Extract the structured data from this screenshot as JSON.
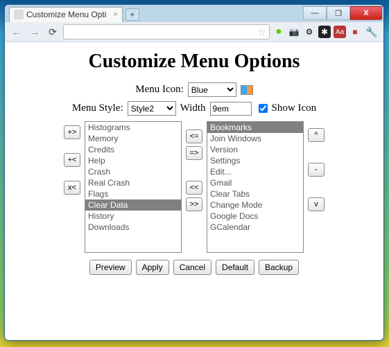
{
  "window": {
    "tab_title": "Customize Menu Opti",
    "tab_close": "×",
    "new_tab": "+",
    "min": "—",
    "max": "❐",
    "close": "X"
  },
  "toolbar": {
    "back": "←",
    "forward": "→",
    "reload": "⟳",
    "star": "☆",
    "wrench": "🔧"
  },
  "ext_icons": {
    "green": "●",
    "camera": "📷",
    "gears": "⚙",
    "asterisk": "✱",
    "aa": "Aa",
    "red": "■"
  },
  "page": {
    "title": "Customize Menu Options",
    "menu_icon_label": "Menu Icon:",
    "menu_icon_value": "Blue",
    "menu_style_label": "Menu Style:",
    "menu_style_value": "Style2",
    "width_label": "Width",
    "width_value": "9em",
    "show_icon_label": "Show Icon"
  },
  "left_list": {
    "items": [
      "Histograms",
      "Memory",
      "Credits",
      "Help",
      "Crash",
      "Real Crash",
      "Flags",
      "Clear Data",
      "History",
      "Downloads"
    ],
    "selected_index": 7
  },
  "right_list": {
    "items": [
      "Bookmarks",
      "Join Windows",
      "Version",
      "Settings",
      "Edit...",
      "Gmail",
      "Clear Tabs",
      "Change Mode",
      "Google Docs",
      "GCalendar"
    ],
    "selected_index": 0
  },
  "buttons": {
    "add_all": "+>",
    "add_sel": "+<",
    "remove": "x<",
    "move_left": "<=",
    "move_right": "=>",
    "move_far_left": "<<",
    "move_far_right": ">>",
    "up": "^",
    "mid": "-",
    "down": "v",
    "preview": "Preview",
    "apply": "Apply",
    "cancel": "Cancel",
    "default": "Default",
    "backup": "Backup"
  }
}
